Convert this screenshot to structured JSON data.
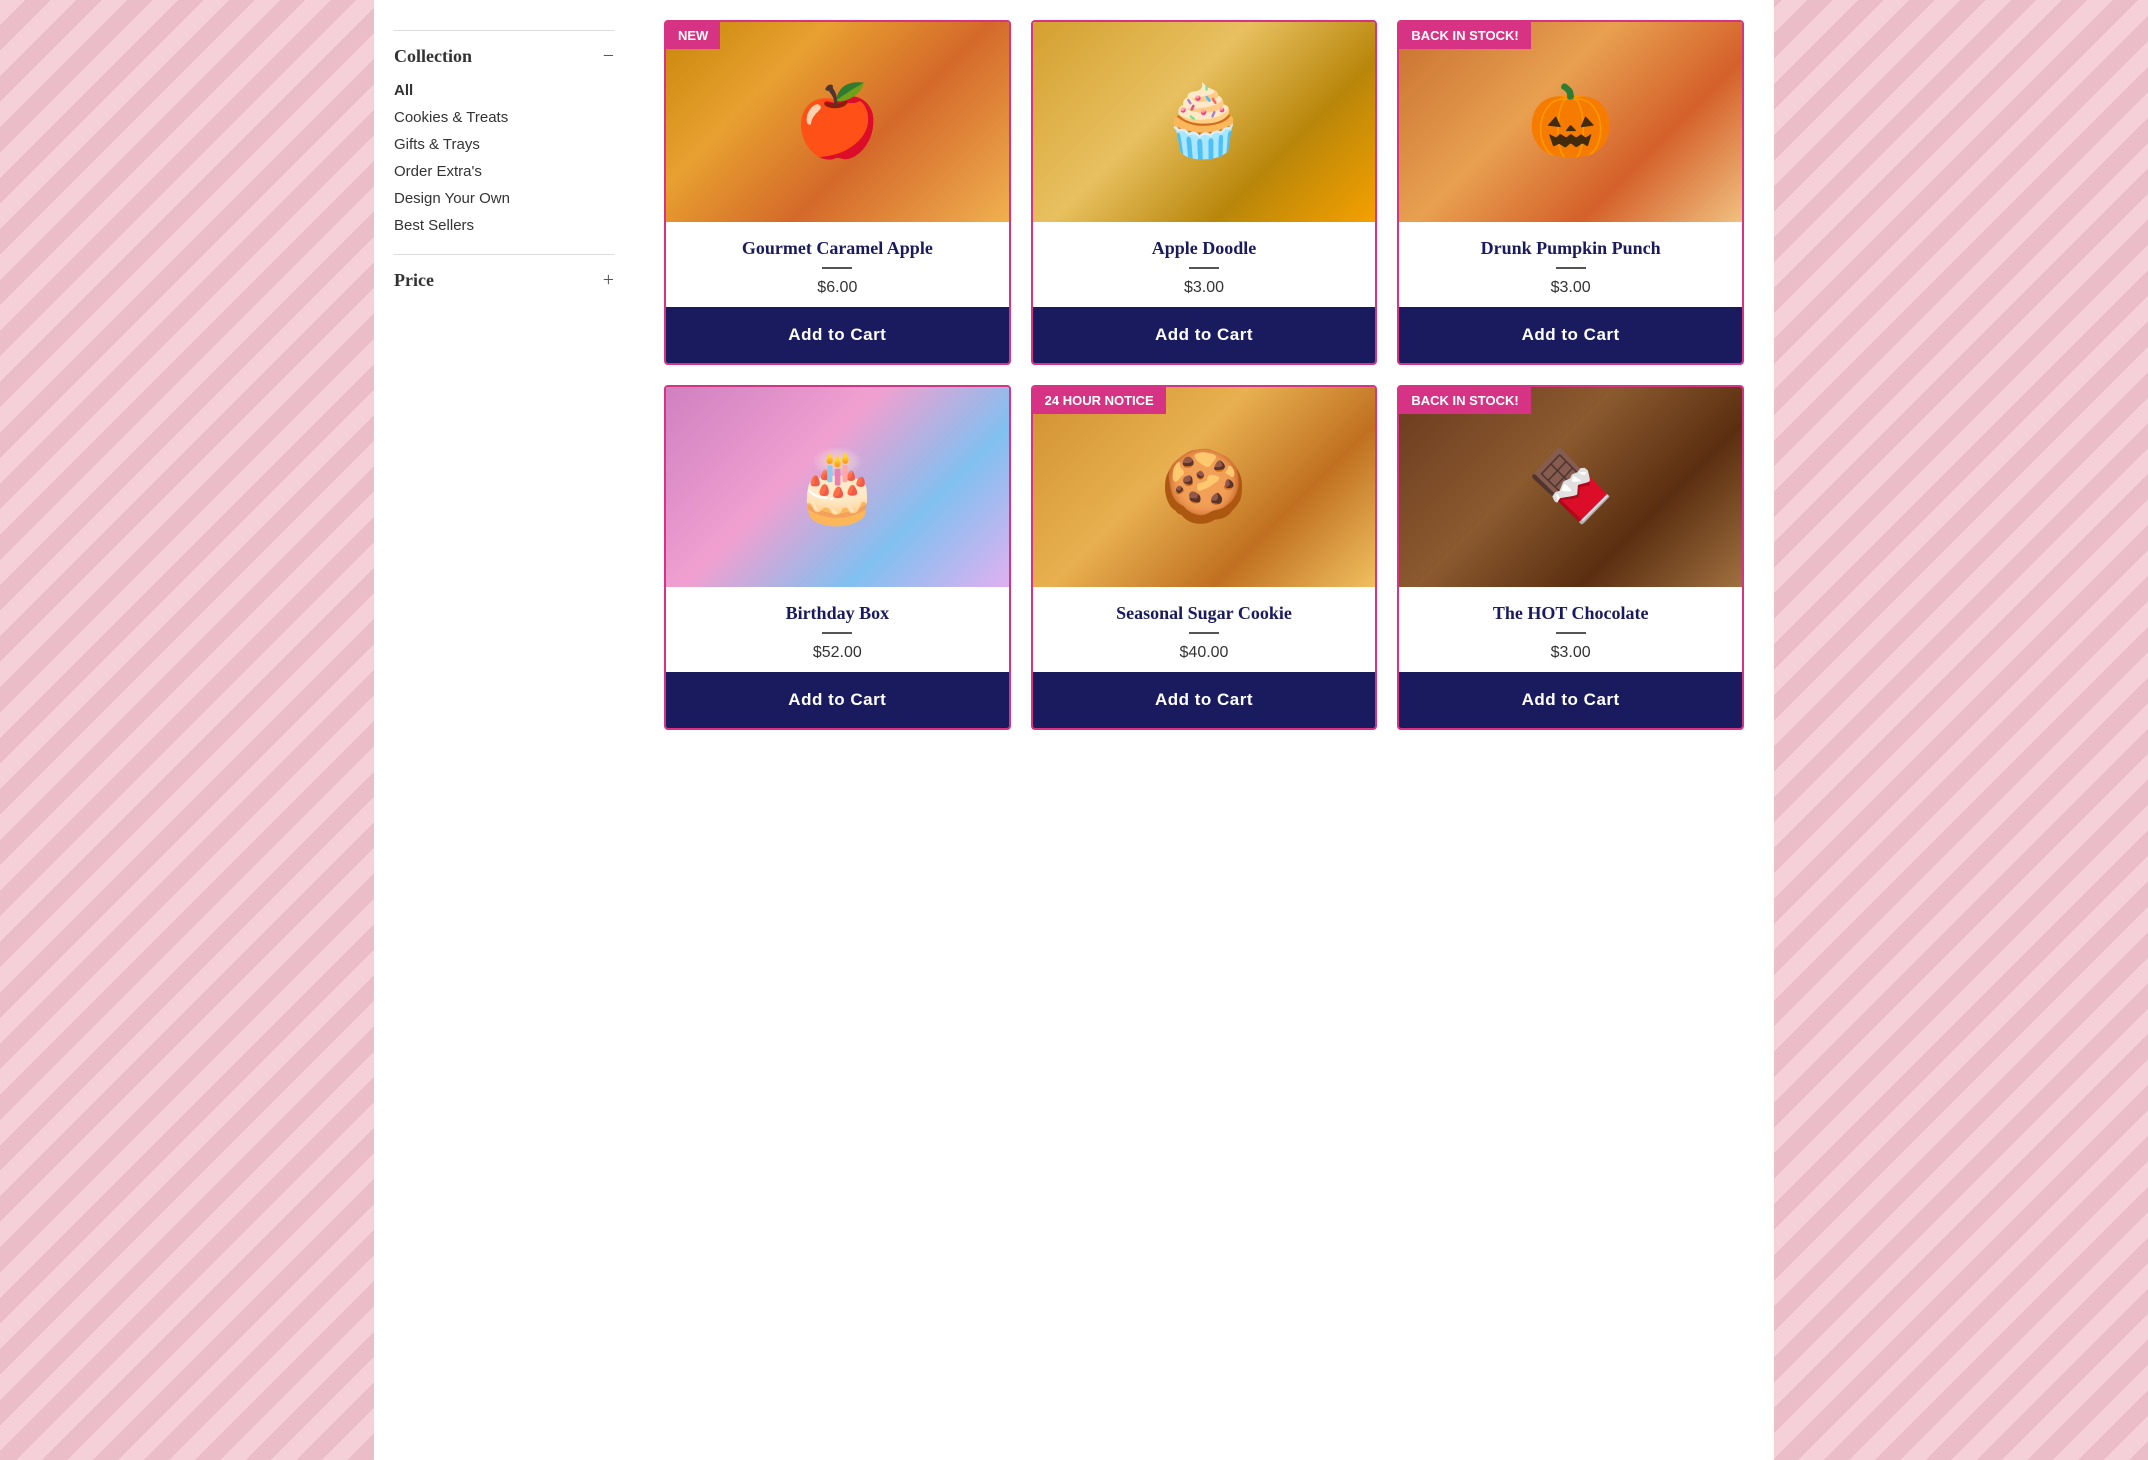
{
  "sidebar": {
    "collection_label": "Collection",
    "collapse_icon": "−",
    "nav_items": [
      {
        "id": "all",
        "label": "All",
        "active": true
      },
      {
        "id": "cookies-treats",
        "label": "Cookies & Treats"
      },
      {
        "id": "gifts-trays",
        "label": "Gifts & Trays"
      },
      {
        "id": "order-extras",
        "label": "Order Extra's"
      },
      {
        "id": "design-your-own",
        "label": "Design Your Own"
      },
      {
        "id": "best-sellers",
        "label": "Best Sellers"
      }
    ],
    "price_label": "Price",
    "price_icon": "+"
  },
  "products": [
    {
      "id": "gourmet-caramel-apple",
      "badge": "NEW",
      "name": "Gourmet Caramel Apple",
      "price": "$6.00",
      "add_to_cart": "Add to Cart",
      "img_class": "img-caramel-apple",
      "img_emoji": "🍎"
    },
    {
      "id": "apple-doodle",
      "badge": null,
      "name": "Apple Doodle",
      "price": "$3.00",
      "add_to_cart": "Add to Cart",
      "img_class": "img-apple-doodle",
      "img_emoji": "🧁"
    },
    {
      "id": "drunk-pumpkin-punch",
      "badge": "BACK IN STOCK!",
      "name": "Drunk Pumpkin Punch",
      "price": "$3.00",
      "add_to_cart": "Add to Cart",
      "img_class": "img-drunk-pumpkin",
      "img_emoji": "🎃"
    },
    {
      "id": "birthday-box",
      "badge": null,
      "name": "Birthday Box",
      "price": "$52.00",
      "add_to_cart": "Add to Cart",
      "img_class": "img-birthday-box",
      "img_emoji": "🎂",
      "notice": null
    },
    {
      "id": "seasonal-sugar-cookie",
      "badge": "24 Hour Notice",
      "name": "Seasonal Sugar Cookie",
      "price": "$40.00",
      "add_to_cart": "Add to Cart",
      "img_class": "img-sugar-cookie",
      "img_emoji": "🍪"
    },
    {
      "id": "the-hot-chocolate",
      "badge": "BACK IN STOCK!",
      "name": "The HOT Chocolate",
      "price": "$3.00",
      "add_to_cart": "Add to Cart",
      "img_class": "img-hot-chocolate",
      "img_emoji": "🍫"
    }
  ]
}
